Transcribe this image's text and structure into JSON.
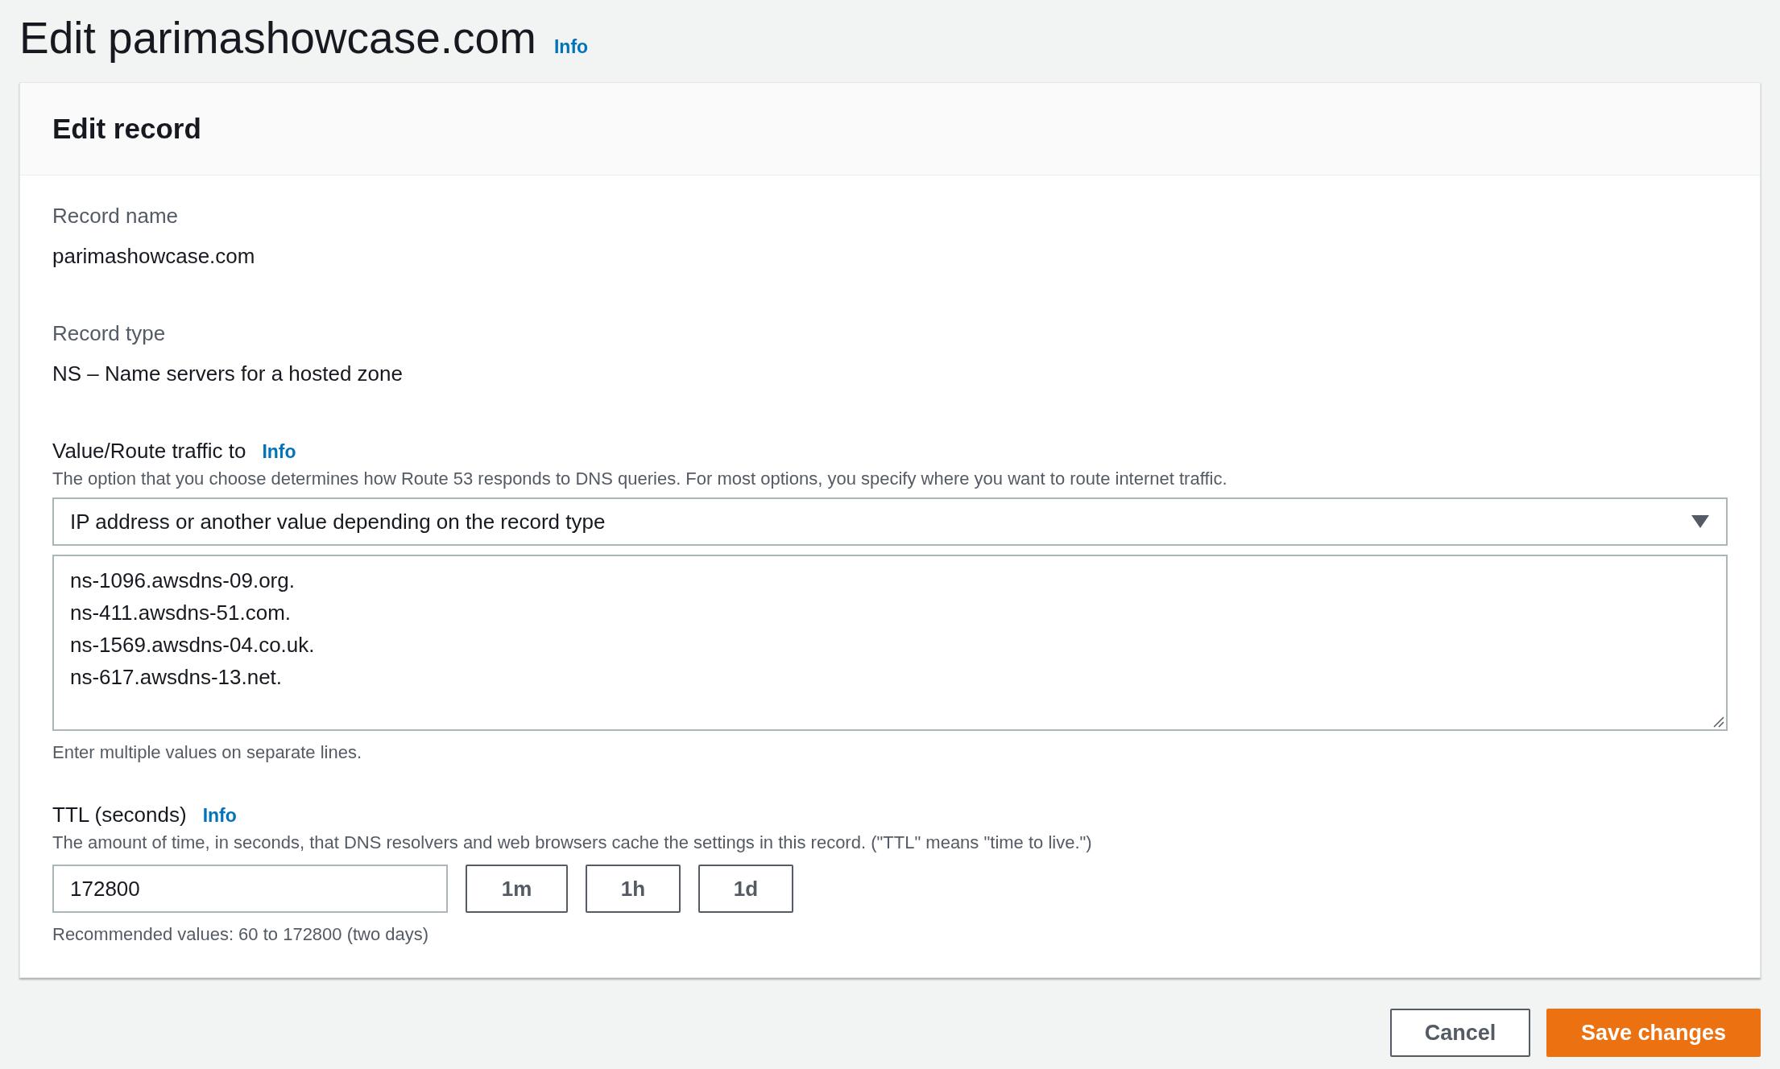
{
  "page": {
    "title": "Edit parimashowcase.com",
    "info": "Info"
  },
  "card": {
    "title": "Edit record"
  },
  "record_name": {
    "label": "Record name",
    "value": "parimashowcase.com"
  },
  "record_type": {
    "label": "Record type",
    "value": "NS – Name servers for a hosted zone"
  },
  "route": {
    "label": "Value/Route traffic to",
    "info": "Info",
    "description": "The option that you choose determines how Route 53 responds to DNS queries. For most options, you specify where you want to route internet traffic.",
    "select": "IP address or another value depending on the record type",
    "values": [
      "ns-1096.awsdns-09.org.",
      "ns-411.awsdns-51.com.",
      "ns-1569.awsdns-04.co.uk.",
      "ns-617.awsdns-13.net."
    ],
    "hint": "Enter multiple values on separate lines."
  },
  "ttl": {
    "label": "TTL (seconds)",
    "info": "Info",
    "description": "The amount of time, in seconds, that DNS resolvers and web browsers cache the settings in this record. (\"TTL\" means \"time to live.\")",
    "value": "172800",
    "presets": [
      "1m",
      "1h",
      "1d"
    ],
    "hint": "Recommended values: 60 to 172800 (two days)"
  },
  "buttons": [
    {
      "label": "Cancel",
      "kind": "secondary"
    },
    {
      "label": "Save changes",
      "kind": "primary"
    }
  ]
}
